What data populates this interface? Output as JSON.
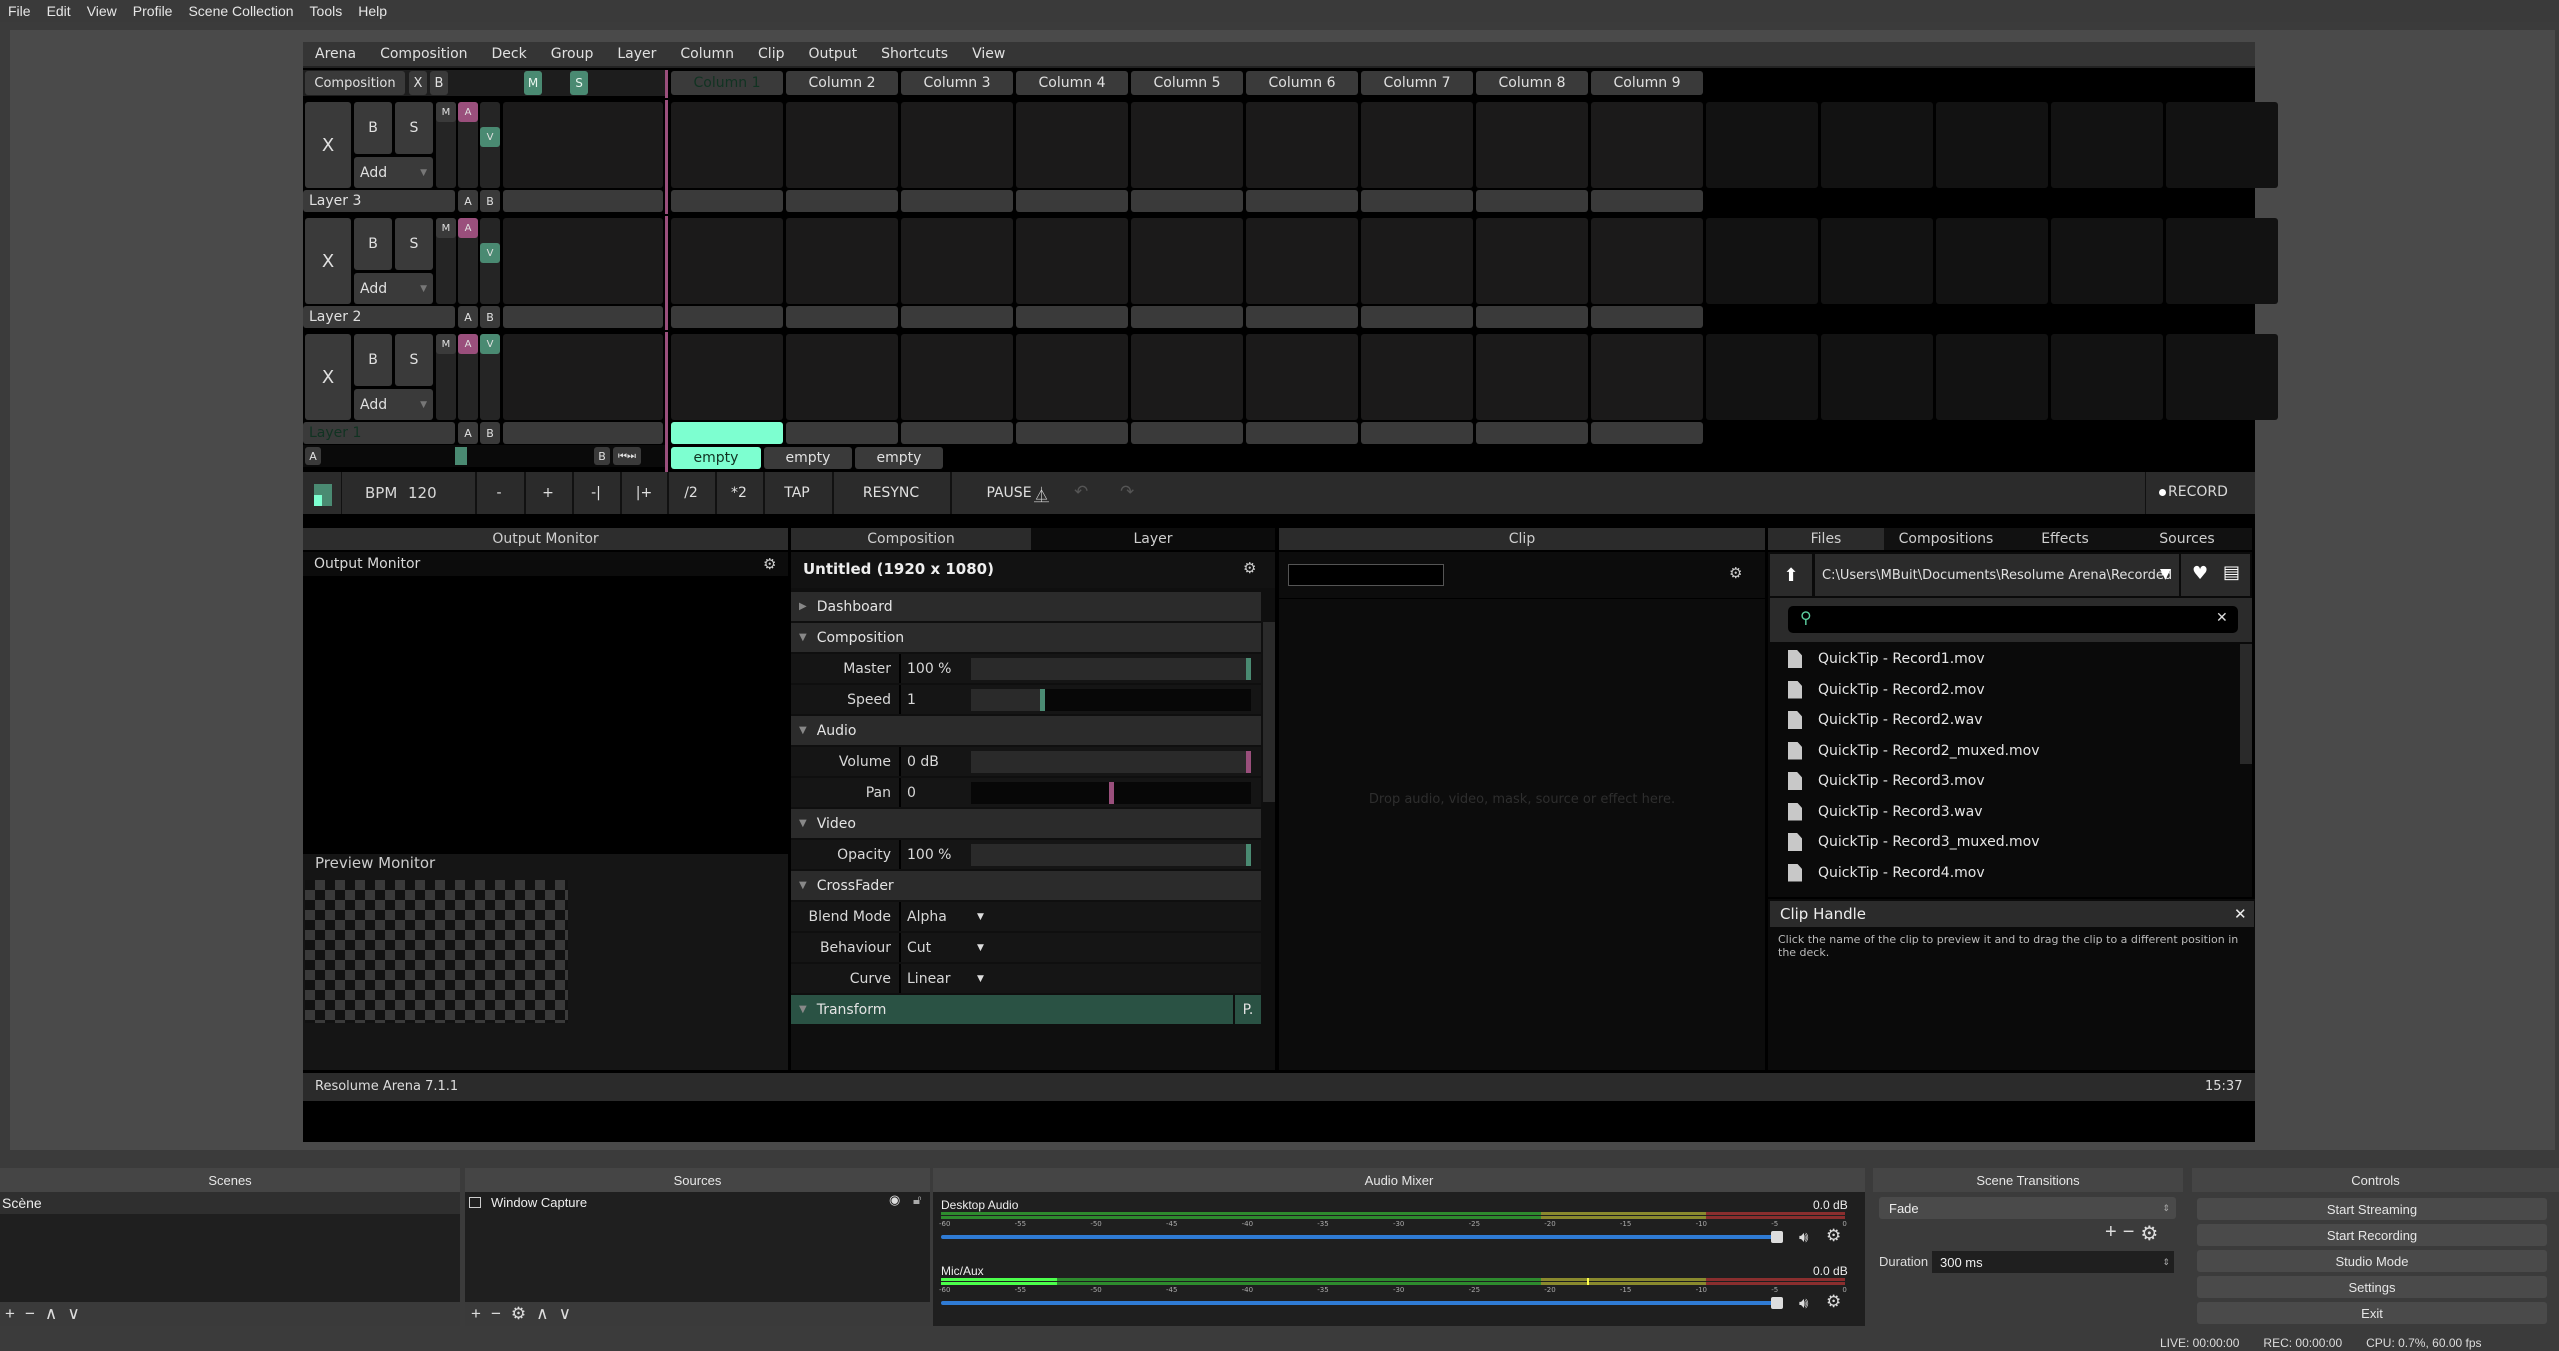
{
  "obs": {
    "menu": [
      "File",
      "Edit",
      "View",
      "Profile",
      "Scene Collection",
      "Tools",
      "Help"
    ],
    "docks": {
      "scenes": {
        "title": "Scenes",
        "items": [
          "Scène"
        ]
      },
      "sources": {
        "title": "Sources",
        "items": [
          "Window Capture"
        ]
      },
      "audio_mixer": {
        "title": "Audio Mixer",
        "channels": [
          {
            "name": "Desktop Audio",
            "level": "0.0 dB",
            "volume_fraction": 1.0
          },
          {
            "name": "Mic/Aux",
            "level": "0.0 dB",
            "volume_fraction": 1.0
          }
        ],
        "scale": [
          "-60",
          "-55",
          "-50",
          "-45",
          "-40",
          "-35",
          "-30",
          "-25",
          "-20",
          "-15",
          "-10",
          "-5",
          "0"
        ]
      },
      "transitions": {
        "title": "Scene Transitions",
        "selected": "Fade",
        "duration_label": "Duration",
        "duration_value": "300 ms"
      },
      "controls": {
        "title": "Controls",
        "buttons": [
          "Start Streaming",
          "Start Recording",
          "Studio Mode",
          "Settings",
          "Exit"
        ]
      }
    },
    "status": {
      "live": "LIVE: 00:00:00",
      "rec": "REC: 00:00:00",
      "cpu": "CPU: 0.7%, 60.00 fps"
    }
  },
  "resolume": {
    "menu": [
      "Arena",
      "Composition",
      "Deck",
      "Group",
      "Layer",
      "Column",
      "Clip",
      "Output",
      "Shortcuts",
      "View"
    ],
    "comp_row": {
      "label": "Composition",
      "x": "X",
      "b": "B",
      "m": "M",
      "s": "S"
    },
    "columns": [
      "Column 1",
      "Column 2",
      "Column 3",
      "Column 4",
      "Column 5",
      "Column 6",
      "Column 7",
      "Column 8",
      "Column 9"
    ],
    "active_column": 0,
    "layers": [
      {
        "name": "Layer 3",
        "x": "X",
        "b": "B",
        "s": "S",
        "add": "Add",
        "m": "M",
        "a": "A",
        "v": "V",
        "ab_a": "A",
        "ab_b": "B",
        "active": false
      },
      {
        "name": "Layer 2",
        "x": "X",
        "b": "B",
        "s": "S",
        "add": "Add",
        "m": "M",
        "a": "A",
        "v": "V",
        "ab_a": "A",
        "ab_b": "B",
        "active": false
      },
      {
        "name": "Layer 1",
        "x": "X",
        "b": "B",
        "s": "S",
        "add": "Add",
        "m": "M",
        "a": "A",
        "v": "V",
        "ab_a": "A",
        "ab_b": "B",
        "active": true
      }
    ],
    "crossfader": {
      "a": "A",
      "b": "B",
      "position": 0.5
    },
    "decks": [
      "empty",
      "empty",
      "empty"
    ],
    "transport": {
      "bpm_label": "BPM",
      "bpm": "120",
      "buttons": [
        "-",
        "+",
        "-|",
        "|+",
        "/2",
        "*2",
        "TAP",
        "RESYNC",
        "PAUSE"
      ],
      "record": "RECORD"
    },
    "panels": {
      "output_monitor": {
        "tab": "Output Monitor",
        "title": "Output Monitor",
        "preview": "Preview Monitor"
      },
      "tabs_mid": [
        "Composition",
        "Layer"
      ],
      "comp_title": "Untitled (1920 x 1080)",
      "sections": {
        "dashboard": "Dashboard",
        "composition": "Composition",
        "audio": "Audio",
        "video": "Video",
        "crossfader": "CrossFader",
        "transform": "Transform",
        "transform_p": "P."
      },
      "params": {
        "master": {
          "label": "Master",
          "value": "100 %",
          "fraction": 1.0
        },
        "speed": {
          "label": "Speed",
          "value": "1",
          "fraction": 0.25
        },
        "volume": {
          "label": "Volume",
          "value": "0 dB",
          "fraction": 1.0
        },
        "pan": {
          "label": "Pan",
          "value": "0",
          "fraction": 0.5
        },
        "opacity": {
          "label": "Opacity",
          "value": "100 %",
          "fraction": 1.0
        },
        "blend": {
          "label": "Blend Mode",
          "value": "Alpha"
        },
        "behaviour": {
          "label": "Behaviour",
          "value": "Cut"
        },
        "curve": {
          "label": "Curve",
          "value": "Linear"
        }
      },
      "clip": {
        "tab": "Clip",
        "placeholder": "Drop audio, video, mask, source or effect here."
      },
      "browser": {
        "tabs": [
          "Files",
          "Compositions",
          "Effects",
          "Sources"
        ],
        "path": "C:\\Users\\MBuit\\Documents\\Resolume Arena\\Recorded",
        "search": "",
        "files": [
          "QuickTip - Record1.mov",
          "QuickTip - Record2.mov",
          "QuickTip - Record2.wav",
          "QuickTip - Record2_muxed.mov",
          "QuickTip - Record3.mov",
          "QuickTip - Record3.wav",
          "QuickTip - Record3_muxed.mov",
          "QuickTip - Record4.mov"
        ]
      },
      "help": {
        "title": "Clip Handle",
        "text": "Click the name of the clip to preview it and to drag the clip to a different position in the deck."
      }
    },
    "status": {
      "version": "Resolume Arena 7.1.1",
      "time": "15:37"
    },
    "colors": {
      "mint": "#7dffd0",
      "teal": "#4a8a72",
      "pink": "#9a4f7c"
    }
  }
}
